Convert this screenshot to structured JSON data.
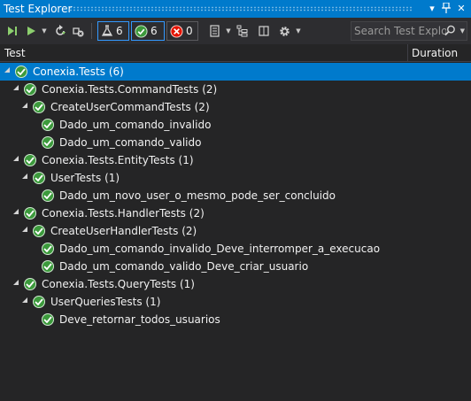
{
  "window": {
    "title": "Test Explorer"
  },
  "toolbar": {
    "flask_count": "6",
    "passed_count": "6",
    "failed_count": "0",
    "search_placeholder": "Search Test Explor"
  },
  "columns": {
    "test": "Test",
    "duration": "Duration"
  },
  "tree": [
    {
      "label": "Conexia.Tests",
      "count": "(6)"
    },
    {
      "label": "Conexia.Tests.CommandTests",
      "count": "(2)"
    },
    {
      "label": "CreateUserCommandTests",
      "count": "(2)"
    },
    {
      "label": "Dado_um_comando_invalido"
    },
    {
      "label": "Dado_um_comando_valido"
    },
    {
      "label": "Conexia.Tests.EntityTests",
      "count": "(1)"
    },
    {
      "label": "UserTests",
      "count": "(1)"
    },
    {
      "label": "Dado_um_novo_user_o_mesmo_pode_ser_concluido"
    },
    {
      "label": "Conexia.Tests.HandlerTests",
      "count": "(2)"
    },
    {
      "label": "CreateUserHandlerTests",
      "count": "(2)"
    },
    {
      "label": "Dado_um_comando_invalido_Deve_interromper_a_execucao"
    },
    {
      "label": "Dado_um_comando_valido_Deve_criar_usuario"
    },
    {
      "label": "Conexia.Tests.QueryTests",
      "count": "(1)"
    },
    {
      "label": "UserQueriesTests",
      "count": "(1)"
    },
    {
      "label": "Deve_retornar_todos_usuarios"
    }
  ],
  "colors": {
    "accent": "#007acc",
    "pass": "#3c9a3c",
    "fail": "#e51400"
  }
}
